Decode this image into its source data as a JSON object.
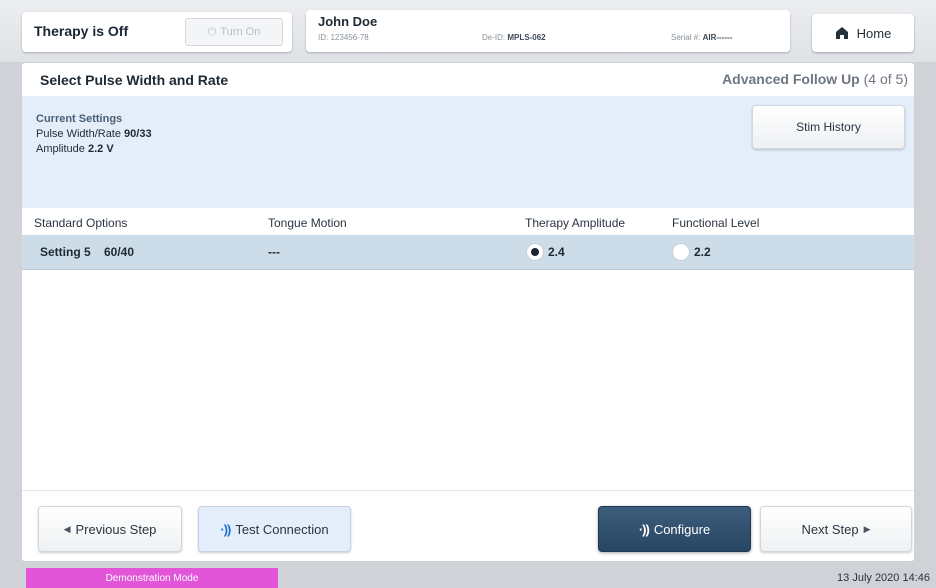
{
  "header": {
    "therapy_status": "Therapy is Off",
    "turn_on_label": "Turn On",
    "patient": {
      "name": "John Doe",
      "id_label": "ID:",
      "id": "123456-78",
      "deid_label": "De-ID:",
      "deid": "MPLS-062",
      "serial_label": "Serial #:",
      "serial": "AIR------"
    },
    "home_label": "Home"
  },
  "screen": {
    "title": "Select Pulse Width and Rate",
    "step_name": "Advanced Follow Up",
    "step_count": "(4 of 5)"
  },
  "current_settings": {
    "title": "Current Settings",
    "pw_label": "Pulse Width/Rate",
    "pw_value": "90/33",
    "amp_label": "Amplitude",
    "amp_value": "2.2 V",
    "stim_history_label": "Stim History"
  },
  "table": {
    "headers": [
      "Standard Options",
      "Tongue Motion",
      "Therapy Amplitude",
      "Functional Level"
    ],
    "rows": [
      {
        "option": "Setting 5",
        "pw": "60/40",
        "tongue_motion": "---",
        "therapy_amplitude": "2.4",
        "therapy_selected": true,
        "functional_level": "2.2",
        "functional_selected": false
      }
    ]
  },
  "footer": {
    "previous_label": "Previous Step",
    "test_label": "Test Connection",
    "configure_label": "Configure",
    "next_label": "Next Step"
  },
  "status_bar": {
    "demo_mode": "Demonstration Mode",
    "datetime": "13 July 2020 14:46"
  },
  "icons": [
    "home-icon",
    "signal-wave-icon",
    "triangle-left-icon",
    "triangle-right-icon",
    "power-icon"
  ],
  "colors": {
    "accent_dark": "#274664",
    "settings_bg": "#e3eefa",
    "row_highlight": "#ccdde9",
    "demo_badge": "#e254d8",
    "wave_blue": "#1f6fd0"
  }
}
